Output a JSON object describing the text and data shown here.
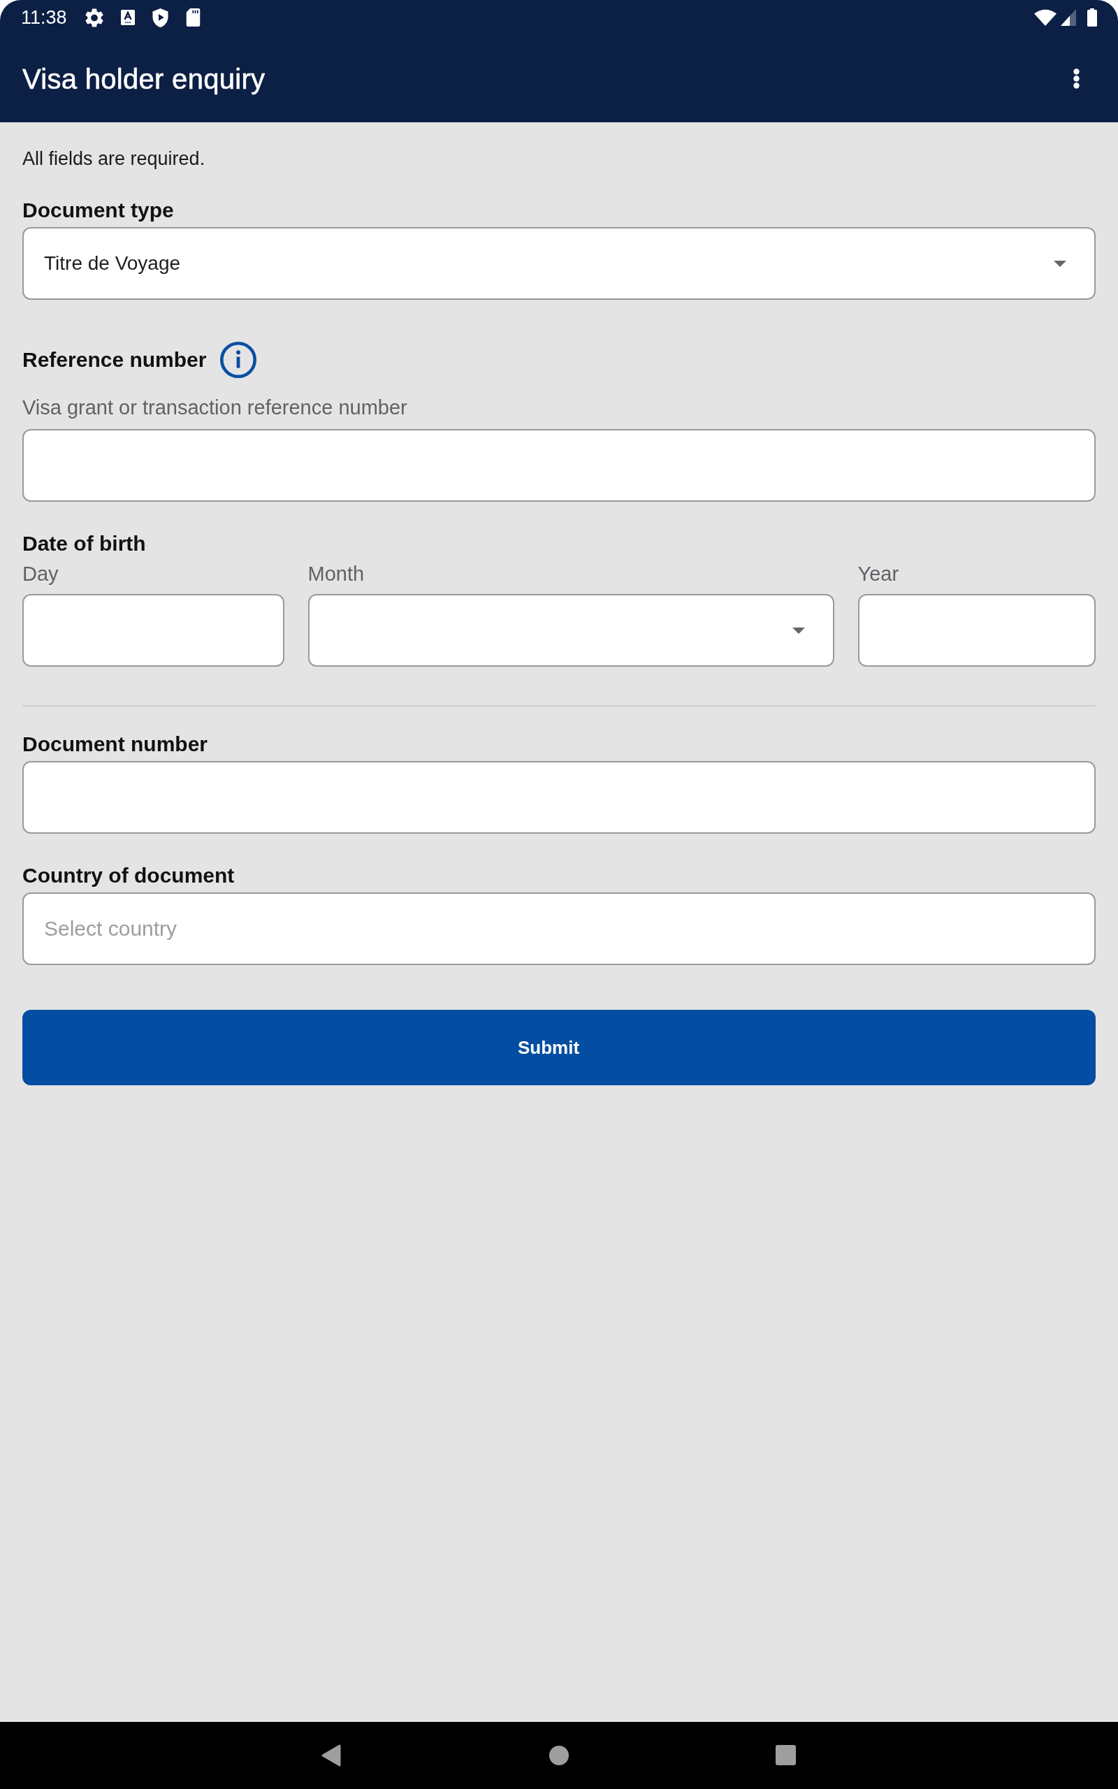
{
  "status_bar": {
    "time": "11:38"
  },
  "app_bar": {
    "title": "Visa holder enquiry"
  },
  "form": {
    "note": "All fields are required.",
    "fields": [
      {
        "kind": "select",
        "label": "Document type",
        "info": false,
        "value": "Titre de Voyage"
      },
      {
        "kind": "text",
        "label": "Reference number",
        "info": true,
        "helper": "Visa grant or transaction reference number"
      },
      {
        "kind": "date",
        "label": "Date of birth",
        "info": false,
        "parts": [
          {
            "kind": "text",
            "label": "Day"
          },
          {
            "kind": "select",
            "label": "Month"
          },
          {
            "kind": "text",
            "label": "Year"
          }
        ]
      },
      {
        "kind": "text",
        "label": "Document number",
        "info": false
      },
      {
        "kind": "text",
        "label": "Country of document",
        "info": false,
        "placeholder": "Select country"
      }
    ],
    "submit": "Submit"
  }
}
